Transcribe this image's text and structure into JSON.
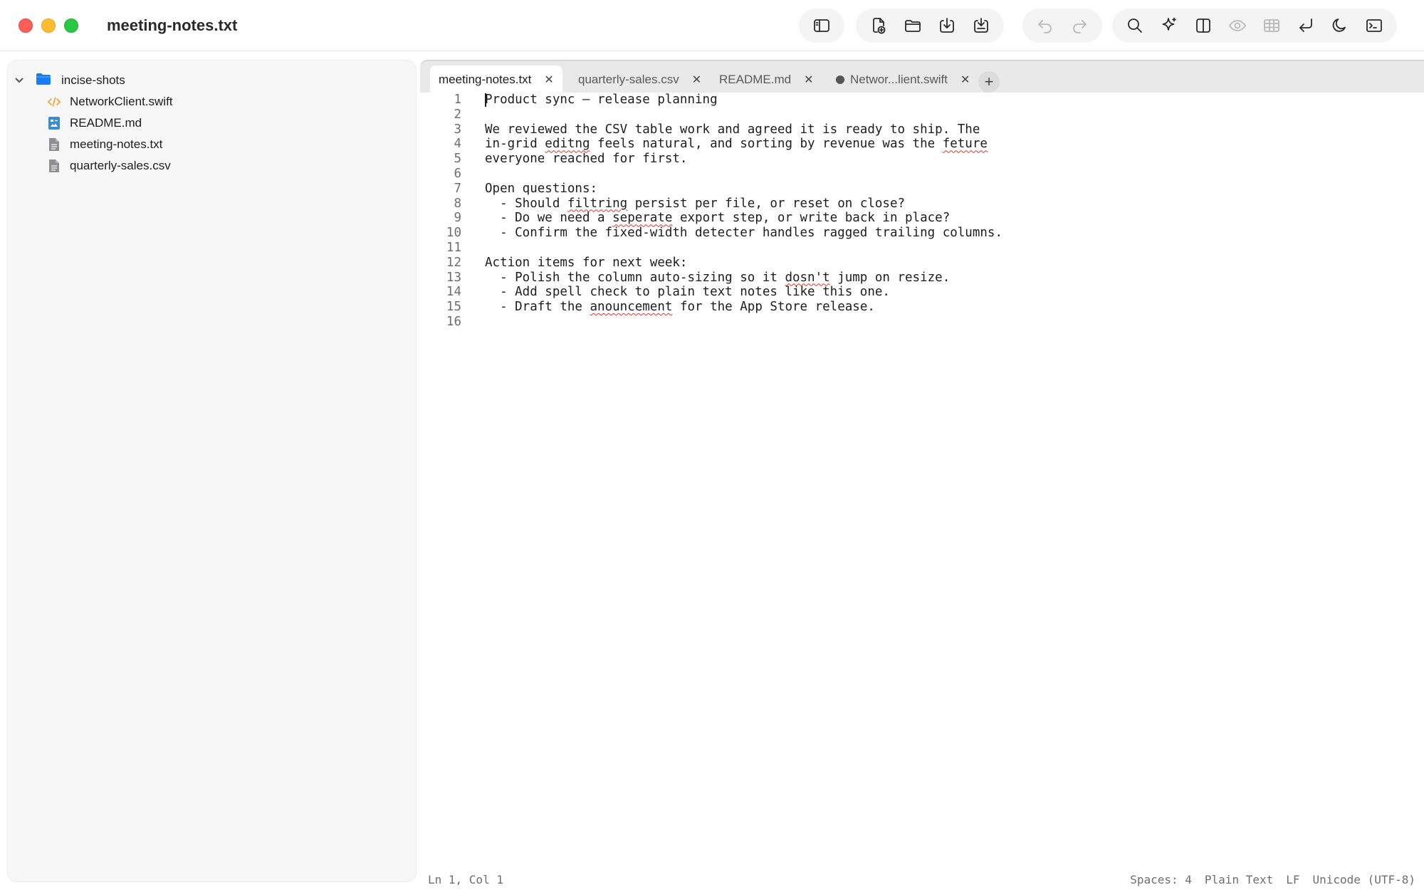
{
  "window": {
    "title": "meeting-notes.txt"
  },
  "toolbar": {
    "groups": [
      [
        "sidebar-toggle-icon"
      ],
      [
        "new-file-icon",
        "open-folder-icon",
        "download-icon",
        "save-icon"
      ],
      [
        "undo-icon",
        "redo-icon"
      ],
      [
        "search-icon",
        "sparkle-icon",
        "split-view-icon",
        "preview-eye-icon",
        "table-icon",
        "word-wrap-icon",
        "dark-mode-icon",
        "terminal-icon"
      ]
    ]
  },
  "sidebar": {
    "root": "incise-shots",
    "items": [
      {
        "label": "NetworkClient.swift",
        "icon": "swift-code-icon"
      },
      {
        "label": "README.md",
        "icon": "markdown-file-icon"
      },
      {
        "label": "meeting-notes.txt",
        "icon": "text-file-icon"
      },
      {
        "label": "quarterly-sales.csv",
        "icon": "csv-file-icon"
      }
    ]
  },
  "tabs": [
    {
      "label": "meeting-notes.txt",
      "active": true,
      "dirty": false
    },
    {
      "label": "quarterly-sales.csv",
      "active": false,
      "dirty": false
    },
    {
      "label": "README.md",
      "active": false,
      "dirty": false
    },
    {
      "label": "Networ...lient.swift",
      "active": false,
      "dirty": true
    }
  ],
  "tab_add_label": "+",
  "tab_close_glyph": "✕",
  "editor": {
    "lines": [
      "Product sync — release planning",
      "",
      "We reviewed the CSV table work and agreed it is ready to ship. The",
      "in-grid editng feels natural, and sorting by revenue was the feture",
      "everyone reached for first.",
      "",
      "Open questions:",
      "  - Should filtring persist per file, or reset on close?",
      "  - Do we need a seperate export step, or write back in place?",
      "  - Confirm the fixed-width detecter handles ragged trailing columns.",
      "",
      "Action items for next week:",
      "  - Polish the column auto-sizing so it dosn't jump on resize.",
      "  - Add spell check to plain text notes like this one.",
      "  - Draft the anouncement for the App Store release.",
      ""
    ],
    "misspelled": [
      "editng",
      "feture",
      "filtring",
      "seperate",
      "dosn't",
      "anouncement"
    ]
  },
  "status": {
    "position": "Ln 1, Col 1",
    "indent": "Spaces: 4",
    "language": "Plain Text",
    "line_ending": "LF",
    "encoding": "Unicode (UTF-8)"
  },
  "colors": {
    "close": "#ff5f57",
    "minimize": "#febc2e",
    "maximize": "#28c840",
    "folder": "#1a7cf5",
    "swift": "#f0a030",
    "markdown": "#3a8ccf",
    "spell_underline": "#e0342c"
  }
}
